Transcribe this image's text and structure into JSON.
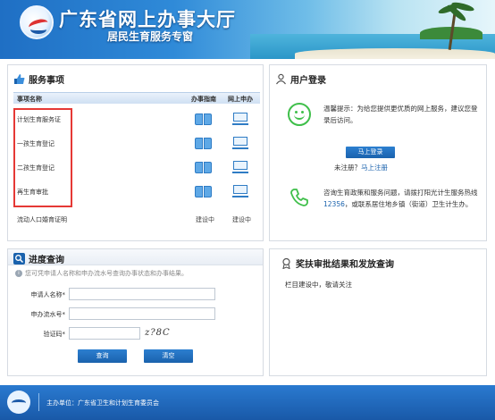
{
  "header": {
    "site_title": "广东省网上办事大厅",
    "subtitle": "居民生育服务专窗"
  },
  "services": {
    "title": "服务事项",
    "col_name": "事项名称",
    "col_guide": "办事指南",
    "col_online": "网上申办",
    "items": [
      {
        "name": "计划生育服务证",
        "guide": "book-icon",
        "online": "computer-icon"
      },
      {
        "name": "一孩生育登记",
        "guide": "book-icon",
        "online": "computer-icon"
      },
      {
        "name": "二孩生育登记",
        "guide": "book-icon",
        "online": "computer-icon"
      },
      {
        "name": "再生育审批",
        "guide": "book-icon",
        "online": "computer-icon"
      },
      {
        "name": "流动人口婚育证明",
        "guide_text": "建设中",
        "online_text": "建设中"
      }
    ]
  },
  "login": {
    "title": "用户登录",
    "tip": "温馨提示：为给您提供更优质的网上服务，建议您登录后访问。",
    "login_button": "马上登录",
    "not_registered": "未注册？",
    "register_link": "马上注册",
    "hotline_before": "咨询生育政策和服务问题，请拨打阳光计生服务热线 ",
    "hotline_number": "12356",
    "hotline_after": "，或联系居住地乡镇（街道）卫生计生办。"
  },
  "progress": {
    "title": "进度查询",
    "hint": "您可凭申请人名称和申办流水号查询办事状态和办事结果。",
    "applicant_label": "申请人名称*",
    "serial_label": "申办流水号*",
    "captcha_label": "验证码*",
    "captcha_text": "z?8C",
    "query_button": "查询",
    "clear_button": "清空"
  },
  "approval": {
    "title": "奖扶审批结果和发放查询",
    "text": "栏目建设中，敬请关注"
  },
  "footer": {
    "text": "主办单位：广东省卫生和计划生育委员会"
  },
  "colors": {
    "primary_blue": "#1a62ad",
    "highlight_red": "#e53935",
    "green": "#3fbf4a"
  }
}
